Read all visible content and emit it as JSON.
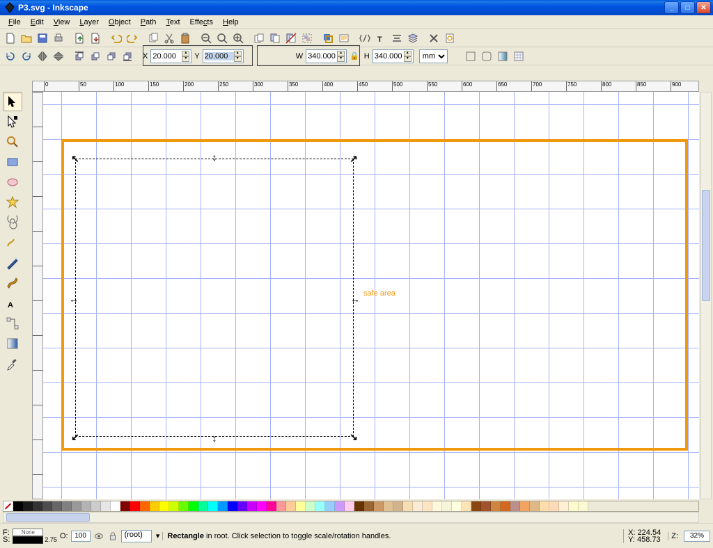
{
  "window": {
    "title": "P3.svg - Inkscape"
  },
  "menus": [
    "File",
    "Edit",
    "View",
    "Layer",
    "Object",
    "Path",
    "Text",
    "Effects",
    "Help"
  ],
  "coords_bar": {
    "x_label": "X",
    "x": "20.000",
    "y_label": "Y",
    "y": "20.000",
    "w_label": "W",
    "w": "340.000",
    "h_label": "H",
    "h": "340.000",
    "units": "mm"
  },
  "canvas": {
    "annotation": "safe area"
  },
  "status": {
    "fill_label": "F:",
    "fill_value": "None",
    "stroke_label": "S:",
    "stroke_width": "2.75",
    "opacity_label": "O:",
    "opacity": "100",
    "layer": "(root)",
    "object": "Rectangle",
    "msg": " in root. Click selection to toggle scale/rotation handles.",
    "x_label": "X:",
    "xval": "224.54",
    "y_label": "Y:",
    "yval": "458.73",
    "z_label": "Z:",
    "zoom": "32%"
  },
  "palette": [
    "none",
    "#000000",
    "#1a1a1a",
    "#333333",
    "#4d4d4d",
    "#666666",
    "#808080",
    "#999999",
    "#b3b3b3",
    "#cccccc",
    "#e6e6e6",
    "#ffffff",
    "#800000",
    "#ff0000",
    "#ff6600",
    "#ffcc00",
    "#ffff00",
    "#ccff00",
    "#66ff00",
    "#00ff00",
    "#00ff99",
    "#00ffff",
    "#0099ff",
    "#0000ff",
    "#6600ff",
    "#cc00ff",
    "#ff00ff",
    "#ff0099",
    "#ff9999",
    "#ffcc99",
    "#ffff99",
    "#ccffcc",
    "#99ffff",
    "#99ccff",
    "#cc99ff",
    "#ffccee",
    "#663300",
    "#996633",
    "#cc9966",
    "#e0c090",
    "#d2b48c",
    "#f5deb3",
    "#faebd7",
    "#ffe4c4",
    "#fff8dc",
    "#f5f5dc",
    "#ffffe0",
    "#ffe4b5",
    "#8b4513",
    "#a0522d",
    "#cd853f",
    "#d2691e",
    "#bc8f8f",
    "#f4a460",
    "#deb887",
    "#ffdead",
    "#ffdab9",
    "#ffefd5",
    "#fffacd",
    "#fafad2"
  ]
}
